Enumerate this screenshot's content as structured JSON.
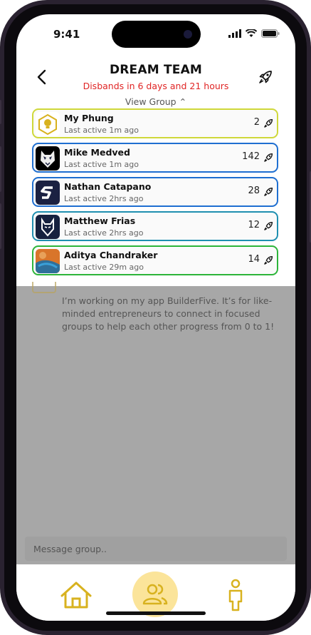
{
  "status": {
    "time": "9:41"
  },
  "header": {
    "title": "DREAM TEAM",
    "subtitle": "Disbands in 6 days and 21 hours",
    "view_group": "View Group ⌃"
  },
  "members": [
    {
      "name": "My Phung",
      "last_active": "Last active 1m ago",
      "score": "2",
      "border_color": "#cfd83a",
      "avatar": "lightbulb-hexagon-icon"
    },
    {
      "name": "Mike Medved",
      "last_active": "Last active 1m ago",
      "score": "142",
      "border_color": "#1f6fd1",
      "avatar": "husky-logo"
    },
    {
      "name": "Nathan Catapano",
      "last_active": "Last active 2hrs ago",
      "score": "28",
      "border_color": "#1f6fd1",
      "avatar": "s-logo"
    },
    {
      "name": "Matthew Frias",
      "last_active": "Last active 2hrs ago",
      "score": "12",
      "border_color": "#1f8fb0",
      "avatar": "wolf-logo"
    },
    {
      "name": "Aditya Chandraker",
      "last_active": "Last active 29m ago",
      "score": "14",
      "border_color": "#2db53a",
      "avatar": "photo"
    }
  ],
  "post": {
    "text": "I’m working on my app BuilderFive. It’s for like-minded entrepreneurs to connect in focused groups to help each other progress from 0 to 1!"
  },
  "composer": {
    "placeholder": "Message group.."
  },
  "tabbar": {
    "items": [
      {
        "name": "home",
        "icon": "home-icon",
        "active": false
      },
      {
        "name": "group",
        "icon": "group-icon",
        "active": true
      },
      {
        "name": "profile",
        "icon": "person-icon",
        "active": false
      }
    ]
  },
  "colors": {
    "accent": "#d8b21f",
    "alert": "#e02424",
    "overlay": "#a7a7a7",
    "active_tab_bg": "#fbe49a"
  }
}
